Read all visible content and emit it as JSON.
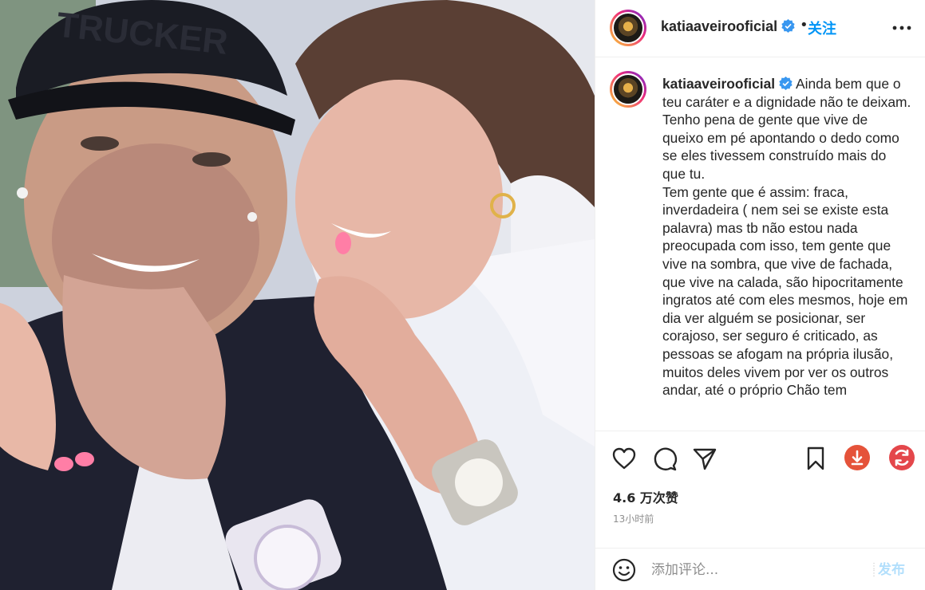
{
  "photo": {
    "cap_text": "TRUCKER"
  },
  "header": {
    "username": "katiaaveirooficial",
    "separator": "•",
    "follow_label": "关注",
    "more_icon": "more-horizontal-icon"
  },
  "caption": {
    "username": "katiaaveirooficial",
    "text": " Ainda bem que o teu caráter e a dignidade não te deixam.\nTenho pena de gente que vive de queixo em pé apontando o dedo como se eles tivessem construído mais do que tu.\nTem gente que é assim: fraca, inverdadeira ( nem sei se existe esta palavra) mas tb não estou nada preocupada com isso, tem gente que vive na sombra, que vive de fachada, que vive na calada, são hipocritamente ingratos até com eles mesmos, hoje em dia ver alguém se posicionar, ser corajoso, ser seguro é criticado, as pessoas se afogam na própria ilusão, muitos deles vivem por ver os outros andar, até o próprio Chão tem"
  },
  "actions": {
    "like_icon": "heart-icon",
    "comment_icon": "comment-icon",
    "share_icon": "send-icon",
    "save_icon": "bookmark-icon",
    "download_icon": "download-icon",
    "refresh_icon": "refresh-icon",
    "likes_text": "4.6 万次赞",
    "time_text": "13小时前"
  },
  "comment": {
    "emoji_icon": "emoji-icon",
    "placeholder": "添加评论...",
    "post_label": "发布"
  },
  "colors": {
    "accent": "#0095f6",
    "post_disabled": "#b2dffc",
    "download_bg": "#e5533a",
    "refresh_bg": "#e4474b",
    "verified": "#3897f0"
  }
}
